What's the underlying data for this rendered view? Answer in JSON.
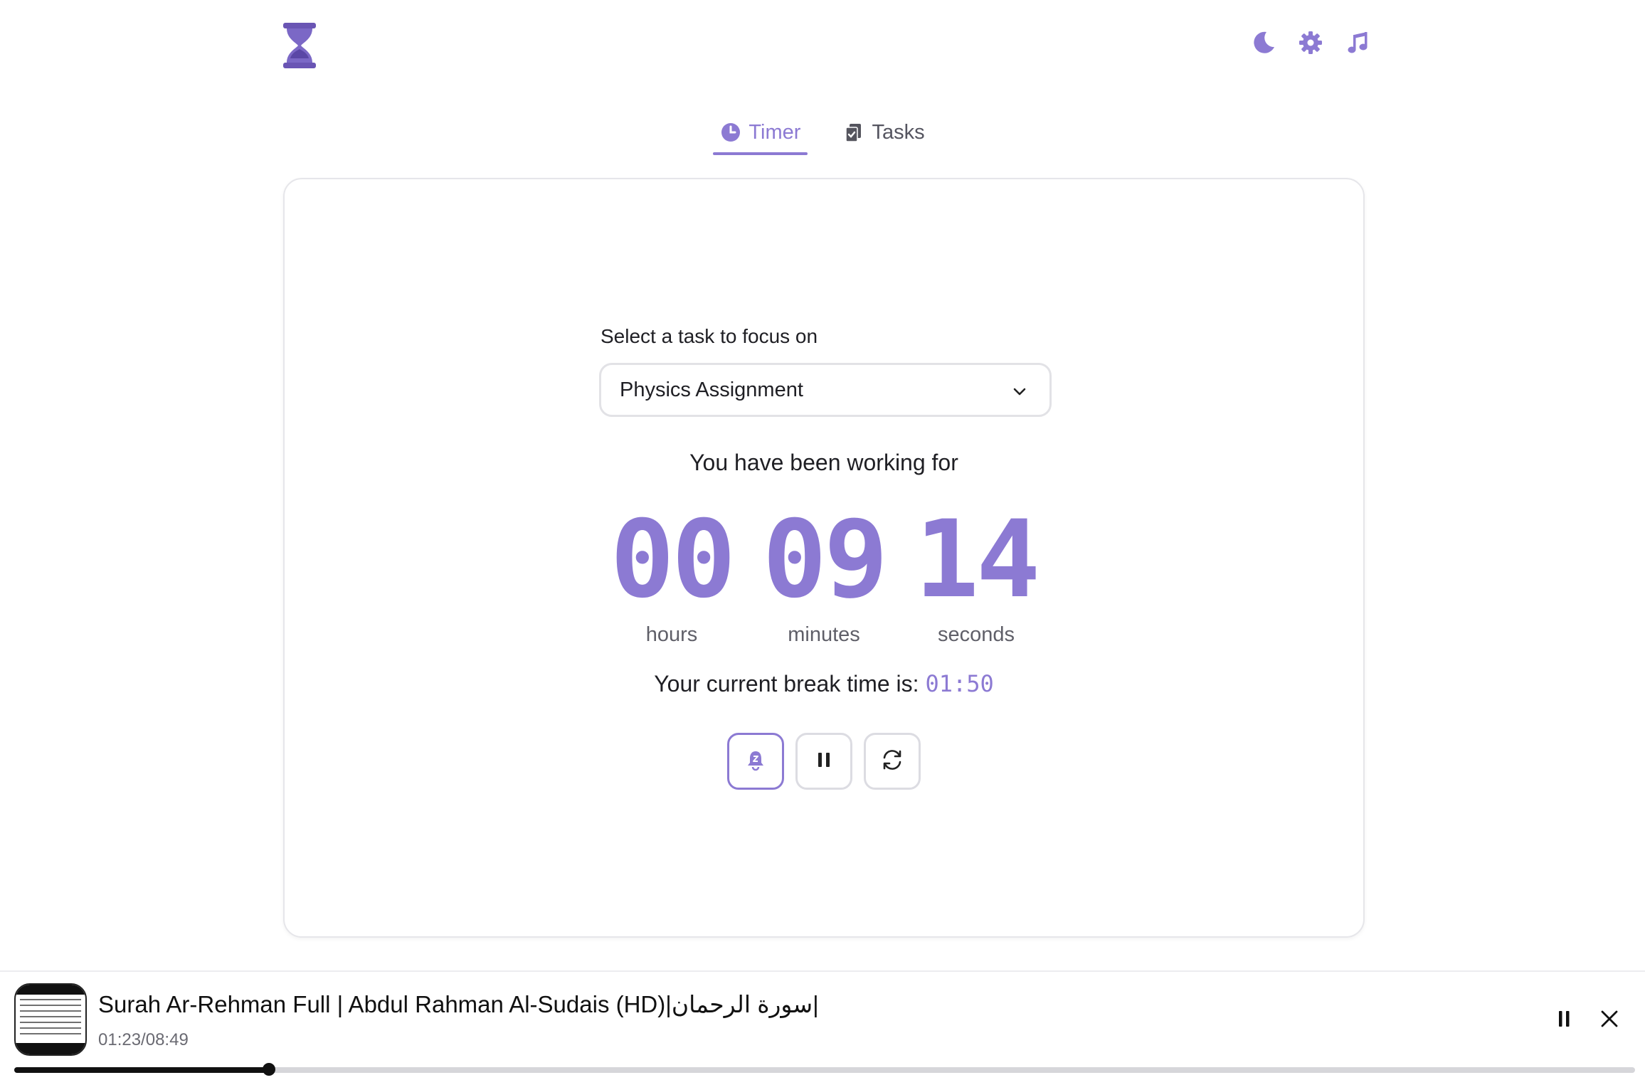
{
  "colors": {
    "accent": "#8c7ad3",
    "text": "#1f1f24",
    "muted": "#5f5f68"
  },
  "header": {
    "logo_icon": "hourglass-icon",
    "icons": [
      "moon-icon",
      "gear-icon",
      "music-note-icon"
    ]
  },
  "tabs": [
    {
      "label": "Timer",
      "icon": "clock-icon",
      "active": true
    },
    {
      "label": "Tasks",
      "icon": "clipboard-check-icon",
      "active": false
    }
  ],
  "focus": {
    "select_label": "Select a task to focus on",
    "selected_task": "Physics Assignment"
  },
  "timer": {
    "working_text": "You have been working for",
    "hours": "00",
    "minutes": "09",
    "seconds": "14",
    "hours_label": "hours",
    "minutes_label": "minutes",
    "seconds_label": "seconds",
    "break_text": "Your current break time is:",
    "break_time": "01:50"
  },
  "controls": [
    "bell-snooze-icon",
    "pause-icon",
    "refresh-icon"
  ],
  "player": {
    "title": "Surah Ar-Rehman Full | Abdul Rahman Al-Sudais (HD)|سورة الرحمان|",
    "time": "01:23/08:49",
    "progress": 0.157
  }
}
